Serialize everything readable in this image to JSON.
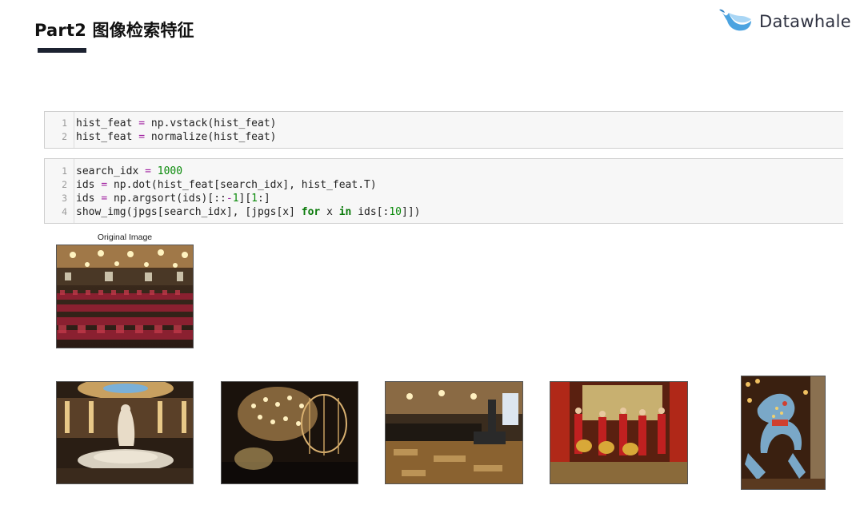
{
  "slide": {
    "title": "Part2 图像检索特征",
    "brand": "Datawhale"
  },
  "cells": [
    {
      "lines": [
        {
          "n": "1",
          "parts": [
            [
              "t",
              "hist_feat "
            ],
            [
              "op",
              "="
            ],
            [
              "t",
              " np.vstack(hist_feat)"
            ]
          ]
        },
        {
          "n": "2",
          "parts": [
            [
              "t",
              "hist_feat "
            ],
            [
              "op",
              "="
            ],
            [
              "t",
              " normalize(hist_feat)"
            ]
          ]
        }
      ]
    },
    {
      "lines": [
        {
          "n": "1",
          "parts": [
            [
              "t",
              "search_idx "
            ],
            [
              "op",
              "="
            ],
            [
              "t",
              " "
            ],
            [
              "num",
              "1000"
            ]
          ]
        },
        {
          "n": "2",
          "parts": [
            [
              "t",
              "ids "
            ],
            [
              "op",
              "="
            ],
            [
              "t",
              " np.dot(hist_feat[search_idx], hist_feat.T)"
            ]
          ]
        },
        {
          "n": "3",
          "parts": [
            [
              "t",
              "ids "
            ],
            [
              "op",
              "="
            ],
            [
              "t",
              " np.argsort(ids)[::"
            ],
            [
              "op",
              "-"
            ],
            [
              "num",
              "1"
            ],
            [
              "t",
              "]["
            ],
            [
              "num",
              "1"
            ],
            [
              "t",
              ":]"
            ]
          ]
        },
        {
          "n": "4",
          "parts": [
            [
              "t",
              "show_img(jpgs[search_idx], [jpgs[x] "
            ],
            [
              "kw",
              "for"
            ],
            [
              "t",
              " x "
            ],
            [
              "kw",
              "in"
            ],
            [
              "t",
              " ids[:"
            ],
            [
              "num",
              "10"
            ],
            [
              "t",
              "]])"
            ]
          ]
        }
      ]
    }
  ],
  "results": {
    "original_label": "Original Image"
  },
  "colors": {
    "accent_bar": "#1c2230",
    "cell_bg": "#f7f7f7",
    "operator": "#a020a0",
    "number": "#0a8a0a"
  }
}
